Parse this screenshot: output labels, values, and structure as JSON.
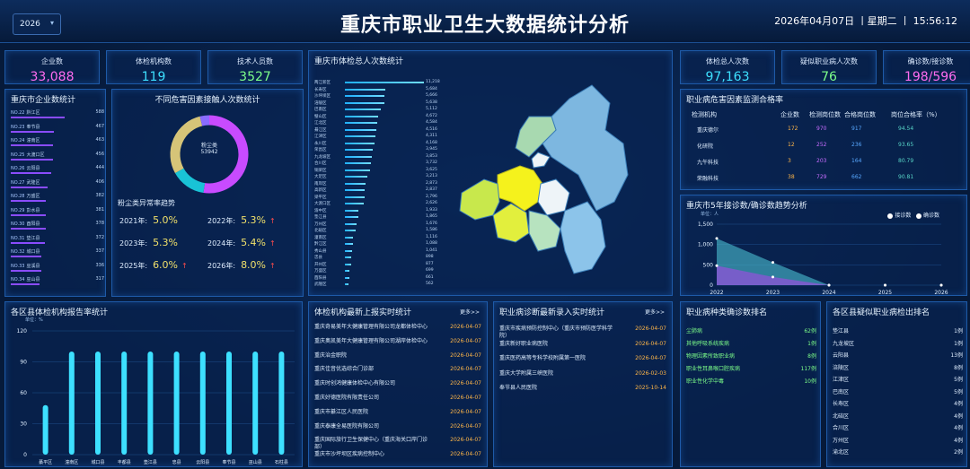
{
  "header": {
    "title": "重庆市职业卫生大数据统计分析",
    "year": "2026",
    "datetime": "2026年04月07日 丨星期二 丨 15:56:12"
  },
  "stats_left": [
    {
      "label": "企业数",
      "value": "33,088",
      "color": "#ff6cf0"
    },
    {
      "label": "体检机构数",
      "value": "119",
      "color": "#3de0ff"
    },
    {
      "label": "技术人员数",
      "value": "3527",
      "color": "#7dff8a"
    }
  ],
  "stats_right": [
    {
      "label": "体检总人次数",
      "value": "97,163",
      "color": "#3de0ff"
    },
    {
      "label": "疑似职业病人次数",
      "value": "76",
      "color": "#7dff8a"
    },
    {
      "label": "确诊数/接诊数",
      "value": "198/596",
      "color": "#ff6cf0"
    }
  ],
  "company_panel": {
    "title": "重庆市企业数统计",
    "rows": [
      {
        "rank": "NO.22",
        "name": "黔江区",
        "value": "588"
      },
      {
        "rank": "NO.23",
        "name": "奉节县",
        "value": "467"
      },
      {
        "rank": "NO.24",
        "name": "潼南区",
        "value": "463"
      },
      {
        "rank": "NO.25",
        "name": "大渡口区",
        "value": "456"
      },
      {
        "rank": "NO.26",
        "name": "云阳县",
        "value": "444"
      },
      {
        "rank": "NO.27",
        "name": "武隆区",
        "value": "406"
      },
      {
        "rank": "NO.28",
        "name": "万盛区",
        "value": "382"
      },
      {
        "rank": "NO.29",
        "name": "彭水县",
        "value": "381"
      },
      {
        "rank": "NO.30",
        "name": "酉阳县",
        "value": "378"
      },
      {
        "rank": "NO.31",
        "name": "垫江县",
        "value": "372"
      },
      {
        "rank": "NO.32",
        "name": "城口县",
        "value": "337"
      },
      {
        "rank": "NO.33",
        "name": "巫溪县",
        "value": "336"
      },
      {
        "rank": "NO.34",
        "name": "巫山县",
        "value": "317"
      }
    ]
  },
  "hazard_panel": {
    "title": "不同危害因素接触人次数统计",
    "donut_label": "粉尘类",
    "donut_value": "53942",
    "donut_segments": [
      {
        "value": 53942,
        "color": "#c84bff"
      },
      {
        "value": 15000,
        "color": "#19c3d6"
      },
      {
        "value": 30000,
        "color": "#d6c478"
      },
      {
        "value": 4000,
        "color": "#8a6cff"
      }
    ],
    "trend_title": "粉尘类异常率趋势",
    "trend": [
      {
        "label": "2021年:",
        "value": "5.0%",
        "up": false
      },
      {
        "label": "2022年:",
        "value": "5.3%",
        "up": true
      },
      {
        "label": "2023年:",
        "value": "5.3%",
        "up": false
      },
      {
        "label": "2024年:",
        "value": "5.4%",
        "up": true
      },
      {
        "label": "2025年:",
        "value": "6.0%",
        "up": true
      },
      {
        "label": "2026年:",
        "value": "8.0%",
        "up": true
      }
    ]
  },
  "map_panel": {
    "title": "重庆市体检总人次数统计",
    "rows": [
      {
        "name": "两江新区",
        "value": "11,218"
      },
      {
        "name": "长寿区",
        "value": "5,684"
      },
      {
        "name": "沙坪坝区",
        "value": "5,666"
      },
      {
        "name": "涪陵区",
        "value": "5,638"
      },
      {
        "name": "巴南区",
        "value": "5,112"
      },
      {
        "name": "璧山区",
        "value": "4,672"
      },
      {
        "name": "江北区",
        "value": "4,584"
      },
      {
        "name": "綦江区",
        "value": "4,516"
      },
      {
        "name": "江津区",
        "value": "4,311"
      },
      {
        "name": "永川区",
        "value": "4,168"
      },
      {
        "name": "荣昌区",
        "value": "3,945"
      },
      {
        "name": "九龙坡区",
        "value": "3,853"
      },
      {
        "name": "合川区",
        "value": "3,732"
      },
      {
        "name": "铜梁区",
        "value": "3,625"
      },
      {
        "name": "大足区",
        "value": "3,213"
      },
      {
        "name": "南岸区",
        "value": "2,873"
      },
      {
        "name": "高新区",
        "value": "2,837"
      },
      {
        "name": "梁平区",
        "value": "2,796"
      },
      {
        "name": "大渡口区",
        "value": "2,626"
      },
      {
        "name": "渝中区",
        "value": "1,933"
      },
      {
        "name": "垫江县",
        "value": "1,865"
      },
      {
        "name": "万州区",
        "value": "1,676"
      },
      {
        "name": "北碚区",
        "value": "1,586"
      },
      {
        "name": "潼南区",
        "value": "1,116"
      },
      {
        "name": "黔江区",
        "value": "1,088"
      },
      {
        "name": "秀山县",
        "value": "1,041"
      },
      {
        "name": "忠县",
        "value": "898"
      },
      {
        "name": "开州区",
        "value": "877"
      },
      {
        "name": "万盛区",
        "value": "699"
      },
      {
        "name": "酉阳县",
        "value": "661"
      },
      {
        "name": "武隆区",
        "value": "562"
      }
    ]
  },
  "pass_panel": {
    "title": "职业病危害因素监测合格率",
    "headers": [
      "检测机构",
      "企业数",
      "检测岗位数",
      "合格岗位数",
      "岗位合格率（%）"
    ],
    "rows": [
      [
        "重庆德尔",
        "172",
        "970",
        "917",
        "94.54"
      ],
      [
        "化研院",
        "12",
        "252",
        "236",
        "93.65"
      ],
      [
        "九午科技",
        "3",
        "203",
        "164",
        "80.79"
      ],
      [
        "荣融科技",
        "38",
        "729",
        "662",
        "90.81"
      ]
    ]
  },
  "trend_panel": {
    "title": "重庆市5年接诊数/确诊数趋势分析",
    "unit": "单位：人",
    "legend": [
      "接诊数",
      "确诊数"
    ],
    "chart_data": {
      "type": "area",
      "x": [
        "2022",
        "2023",
        "2024",
        "2025",
        "2026"
      ],
      "ylim": [
        0,
        1500
      ],
      "yticks": [
        "1,500",
        "1,000",
        "500",
        "0"
      ],
      "series": [
        {
          "name": "接诊数",
          "values": [
            1150,
            560,
            0,
            0,
            0
          ]
        },
        {
          "name": "确诊数",
          "values": [
            480,
            200,
            0,
            0,
            0
          ]
        }
      ]
    }
  },
  "report_panel": {
    "title": "各区县体检机构报告率统计",
    "unit": "单位：%",
    "chart_data": {
      "type": "bar",
      "categories": [
        "綦平区",
        "潼南区",
        "城口县",
        "丰都县",
        "垫江县",
        "忠县",
        "云阳县",
        "奉节县",
        "巫山县",
        "石柱县"
      ],
      "values": [
        48,
        100,
        100,
        100,
        100,
        100,
        100,
        100,
        100,
        100
      ],
      "ylim": [
        0,
        120
      ],
      "yticks": [
        "120",
        "90",
        "60",
        "30",
        "0"
      ]
    }
  },
  "inst_panel": {
    "title": "体检机构最新上报实时统计",
    "more": "更多>>",
    "rows": [
      {
        "name": "重庆奇易美年大健康管理有限公司龙都体检中心",
        "date": "2026-04-07"
      },
      {
        "name": "重庆奥凯美年大健康管理有限公司湖岸体检中心",
        "date": "2026-04-07"
      },
      {
        "name": "重庆治金职院",
        "date": "2026-04-07"
      },
      {
        "name": "重庆佳音优选综合门诊部",
        "date": "2026-04-07"
      },
      {
        "name": "重庆时创鸿健康体检中心有限公司",
        "date": "2026-04-07"
      },
      {
        "name": "重庆好德医院有限责任公司",
        "date": "2026-04-07"
      },
      {
        "name": "重庆市綦江区人民医院",
        "date": "2026-04-07"
      },
      {
        "name": "重庆泰康全易医院有限公司",
        "date": "2026-04-07"
      },
      {
        "name": "重庆国际旅行卫生保健中心（重庆海关口岸门诊部）",
        "date": "2026-04-07"
      },
      {
        "name": "重庆市沙坪坝区疾病控制中心",
        "date": "2026-04-07"
      }
    ]
  },
  "diag_panel": {
    "title": "职业病诊断最新录入实时统计",
    "more": "更多>>",
    "rows": [
      {
        "name": "重庆市疾病预防控制中心（重庆市预防医学科学院）",
        "date": "2026-04-07"
      },
      {
        "name": "重庆新好职业病医院",
        "date": "2026-04-07"
      },
      {
        "name": "重庆医药高等专科学校附属第一医院",
        "date": "2026-04-07"
      },
      {
        "name": "重庆大学附属三峡医院",
        "date": "2026-02-03"
      },
      {
        "name": "奉节县人民医院",
        "date": "2025-10-14"
      }
    ]
  },
  "disease_panel": {
    "title": "职业病种类确诊数排名",
    "rows": [
      {
        "name": "尘肺病",
        "value": "62例"
      },
      {
        "name": "其他呼吸系统疾病",
        "value": "1例"
      },
      {
        "name": "物理因素所致职业病",
        "value": "8例"
      },
      {
        "name": "职业性耳鼻喉口腔疾病",
        "value": "117例"
      },
      {
        "name": "职业性化学中毒",
        "value": "10例"
      }
    ]
  },
  "suspect_panel": {
    "title": "各区县疑似职业病检出排名",
    "rows": [
      {
        "name": "垫江县",
        "value": "1例"
      },
      {
        "name": "九龙坡区",
        "value": "1例"
      },
      {
        "name": "云阳县",
        "value": "13例"
      },
      {
        "name": "涪陵区",
        "value": "8例"
      },
      {
        "name": "江津区",
        "value": "5例"
      },
      {
        "name": "巴南区",
        "value": "5例"
      },
      {
        "name": "长寿区",
        "value": "4例"
      },
      {
        "name": "北碚区",
        "value": "4例"
      },
      {
        "name": "合川区",
        "value": "4例"
      },
      {
        "name": "万州区",
        "value": "4例"
      },
      {
        "name": "渝北区",
        "value": "2例"
      }
    ]
  }
}
